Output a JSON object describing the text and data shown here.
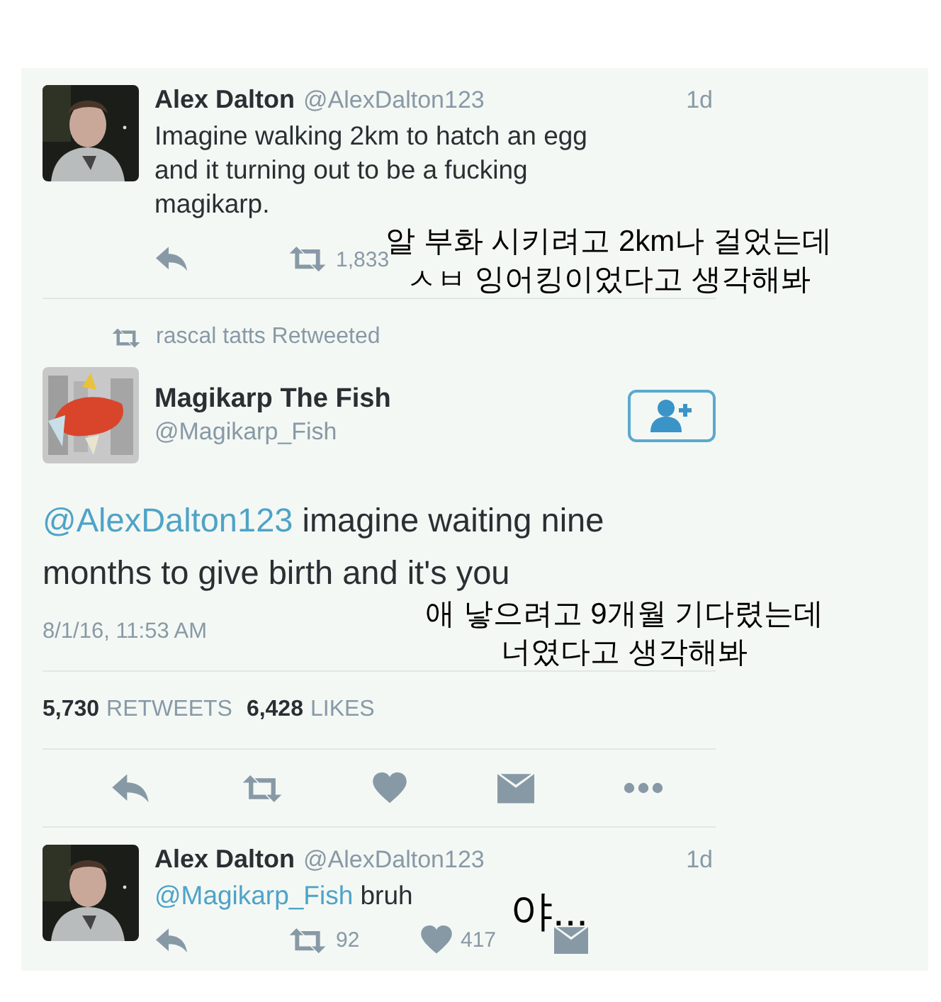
{
  "tweet_1": {
    "name": "Alex Dalton",
    "handle": "@AlexDalton123",
    "time": "1d",
    "text_lines": [
      "Imagine walking 2km to hatch an egg",
      "and it turning out to be a fucking",
      "magikarp."
    ],
    "retweet_count": "1,833"
  },
  "retweet_notice": "rascal tatts Retweeted",
  "main_tweet": {
    "name": "Magikarp The Fish",
    "handle": "@Magikarp_Fish",
    "mention": "@AlexDalton123",
    "text_lines": [
      "imagine waiting nine",
      "months to give birth and it's you"
    ],
    "timestamp": "8/1/16, 11:53 AM",
    "retweets_count": "5,730",
    "retweets_label": "RETWEETS",
    "likes_count": "6,428",
    "likes_label": "LIKES"
  },
  "reply_tweet": {
    "name": "Alex Dalton",
    "handle": "@AlexDalton123",
    "time": "1d",
    "mention": "@Magikarp_Fish",
    "text": "bruh",
    "retweet_count": "92",
    "like_count": "417"
  },
  "captions": [
    {
      "lines": [
        "알 부화 시키려고 2km나 걸었는데",
        "ㅅㅂ 잉어킹이었다고 생각해봐"
      ]
    },
    {
      "lines": [
        "애 낳으려고 9개월 기다렸는데",
        "너였다고 생각해봐"
      ]
    },
    {
      "lines": [
        "야..."
      ]
    }
  ]
}
